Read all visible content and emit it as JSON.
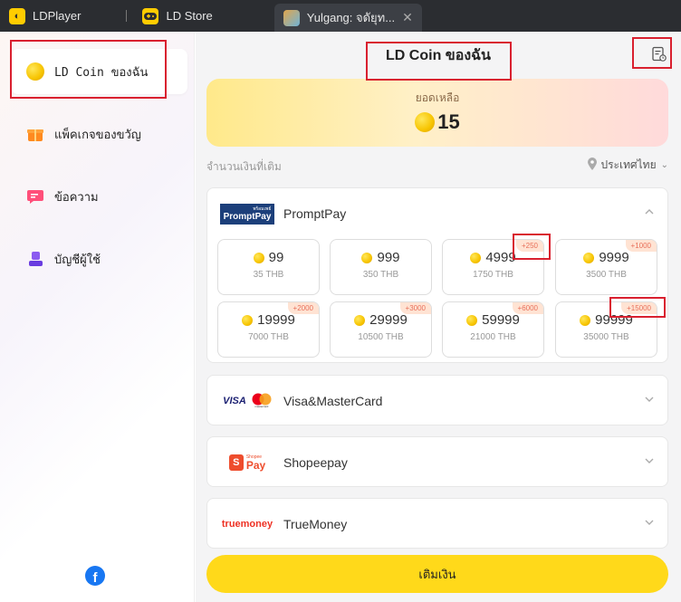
{
  "tabs": [
    {
      "label": "LDPlayer",
      "icon": "ldplayer-icon"
    },
    {
      "label": "LD Store",
      "icon": "gamepad-icon"
    },
    {
      "label": "Yulgang: จดัยุท...",
      "icon": "game-thumbnail-icon"
    }
  ],
  "sidebar": {
    "items": [
      {
        "label": "LD Coin ของฉัน",
        "icon": "coin-icon"
      },
      {
        "label": "แพ็คเกจของขวัญ",
        "icon": "gift-icon"
      },
      {
        "label": "ข้อความ",
        "icon": "message-icon"
      },
      {
        "label": "บัญชีผู้ใช้",
        "icon": "user-icon"
      }
    ],
    "footer_icon": "facebook-icon",
    "footer_glyph": "f"
  },
  "main": {
    "title": "LD Coin ของฉัน",
    "balance_label": "ยอดเหลือ",
    "balance_value": "15",
    "amount_label": "จำนวนเงินที่เติม",
    "country": "ประเทศไทย",
    "submit_label": "เติมเงิน"
  },
  "payment_methods": [
    {
      "name": "PromptPay",
      "logo": "PromptPay",
      "logo_small": "พร้อมเพย์",
      "expanded": true
    },
    {
      "name": "Visa&MasterCard",
      "logo": "VISA",
      "logo_small": "mastercard",
      "expanded": false
    },
    {
      "name": "Shopeepay",
      "logo": "Pay",
      "logo_small": "Shopee",
      "expanded": false
    },
    {
      "name": "TrueMoney",
      "logo": "truemoney",
      "expanded": false
    }
  ],
  "packages": [
    {
      "coins": "99",
      "price": "35 THB",
      "bonus": ""
    },
    {
      "coins": "999",
      "price": "350 THB",
      "bonus": ""
    },
    {
      "coins": "4999",
      "price": "1750 THB",
      "bonus": "+250"
    },
    {
      "coins": "9999",
      "price": "3500 THB",
      "bonus": "+1000"
    },
    {
      "coins": "19999",
      "price": "7000 THB",
      "bonus": "+2000"
    },
    {
      "coins": "29999",
      "price": "10500 THB",
      "bonus": "+3000"
    },
    {
      "coins": "59999",
      "price": "21000 THB",
      "bonus": "+6000"
    },
    {
      "coins": "99999",
      "price": "35000 THB",
      "bonus": "+15000"
    }
  ],
  "colors": {
    "accent_yellow": "#ffd91a",
    "highlight_red": "#d9202f",
    "bonus_text": "#e8705a",
    "tab_bar": "#2b2d31"
  }
}
